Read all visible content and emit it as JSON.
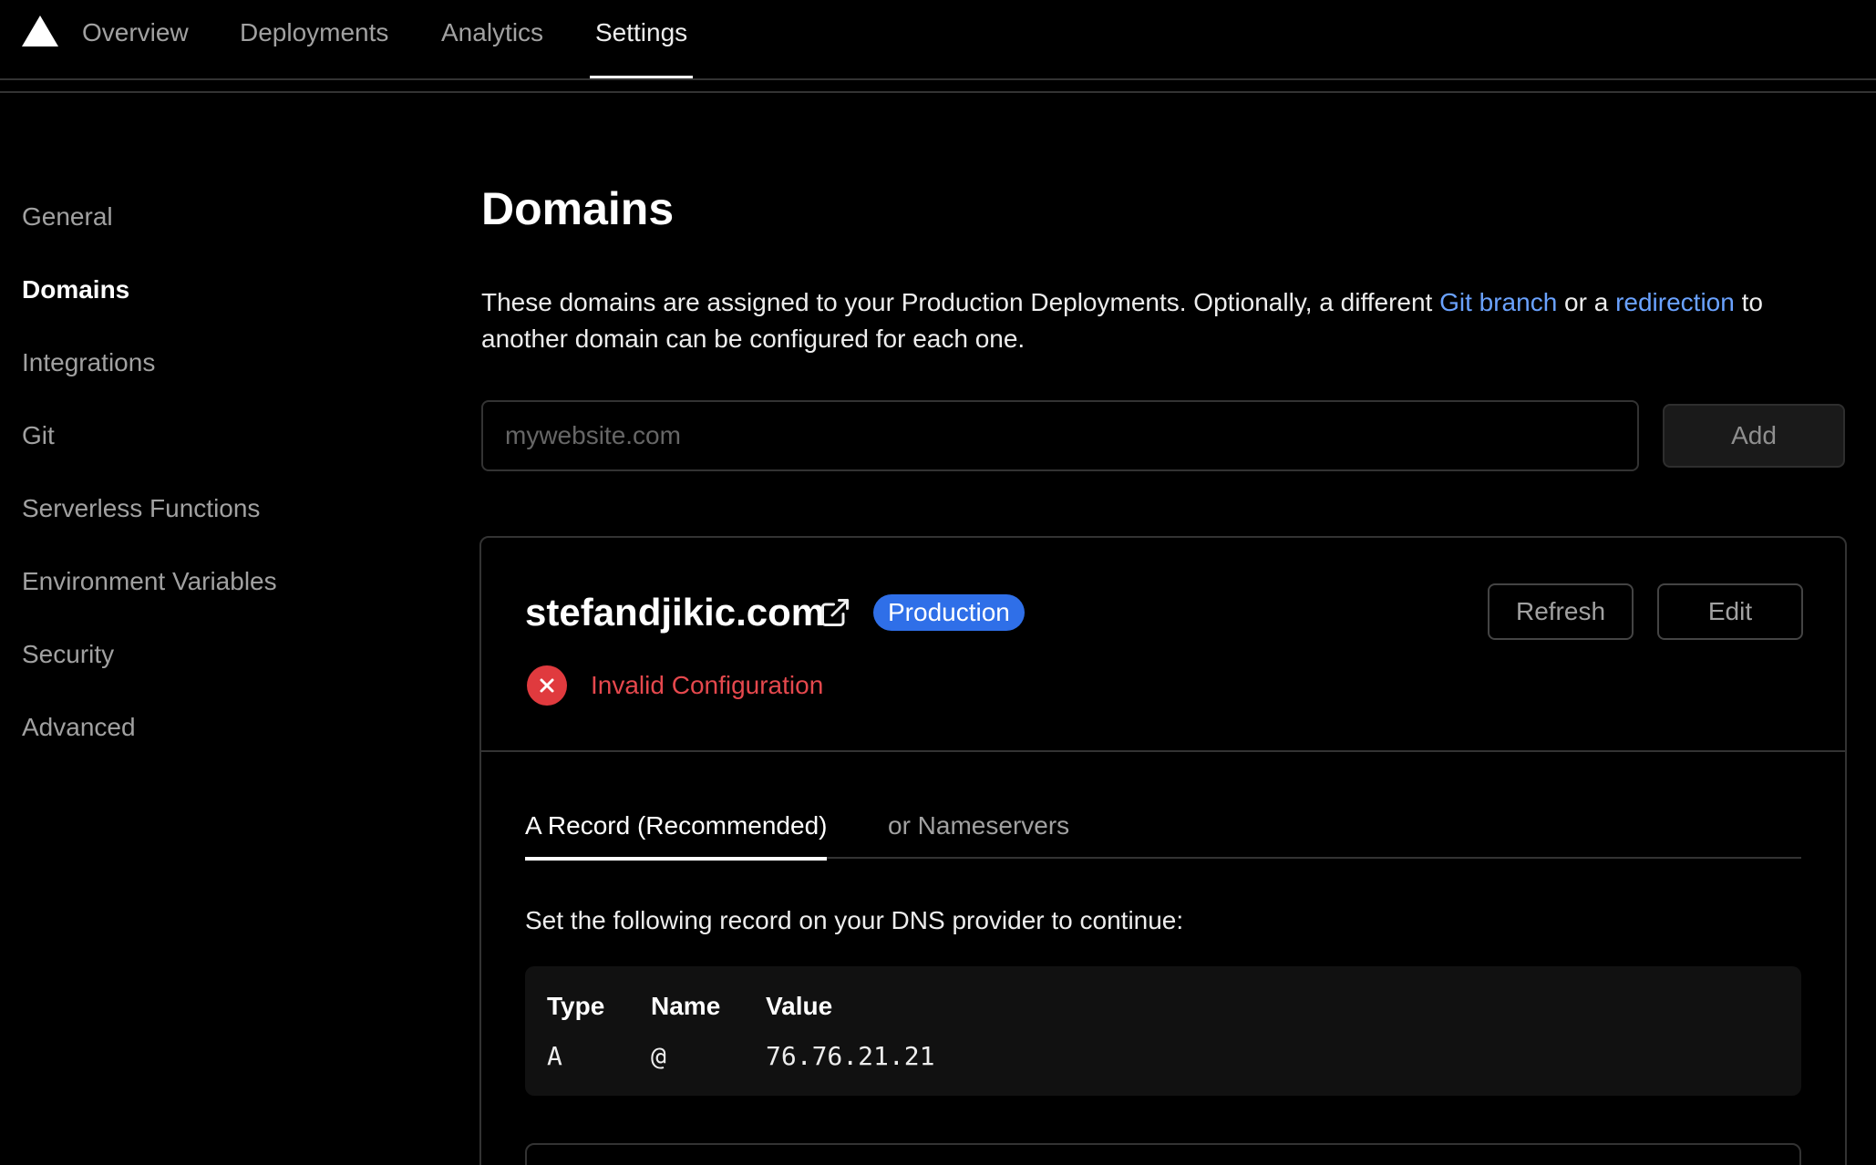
{
  "topnav": {
    "logo_icon": "triangle-logo-icon",
    "tabs": [
      {
        "label": "Overview"
      },
      {
        "label": "Deployments"
      },
      {
        "label": "Analytics"
      },
      {
        "label": "Settings",
        "active": true
      }
    ]
  },
  "sidebar": {
    "items": [
      {
        "label": "General"
      },
      {
        "label": "Domains",
        "active": true
      },
      {
        "label": "Integrations"
      },
      {
        "label": "Git"
      },
      {
        "label": "Serverless Functions"
      },
      {
        "label": "Environment Variables"
      },
      {
        "label": "Security"
      },
      {
        "label": "Advanced"
      }
    ]
  },
  "main": {
    "title": "Domains",
    "description": {
      "part1": "These domains are assigned to your Production Deployments. Optionally, a different ",
      "link1": "Git branch",
      "part2": " or a ",
      "link2": "redirection",
      "part3": " to another domain can be configured for each one."
    },
    "input_placeholder": "mywebsite.com",
    "add_label": "Add"
  },
  "domain_card": {
    "name": "stefandjikic.com",
    "badge": "Production",
    "refresh_label": "Refresh",
    "edit_label": "Edit",
    "status": "Invalid Configuration",
    "tabs": [
      {
        "label": "A Record (Recommended)",
        "active": true
      },
      {
        "label": "or Nameservers"
      }
    ],
    "instructions": "Set the following record on your DNS provider to continue:",
    "table": {
      "headers": [
        "Type",
        "Name",
        "Value"
      ],
      "row": [
        "A",
        "@",
        "76.76.21.21"
      ]
    }
  },
  "colors": {
    "background": "#000000",
    "link": "#6aa2ff",
    "badge": "#2f6fe8",
    "error": "#e5484d"
  }
}
